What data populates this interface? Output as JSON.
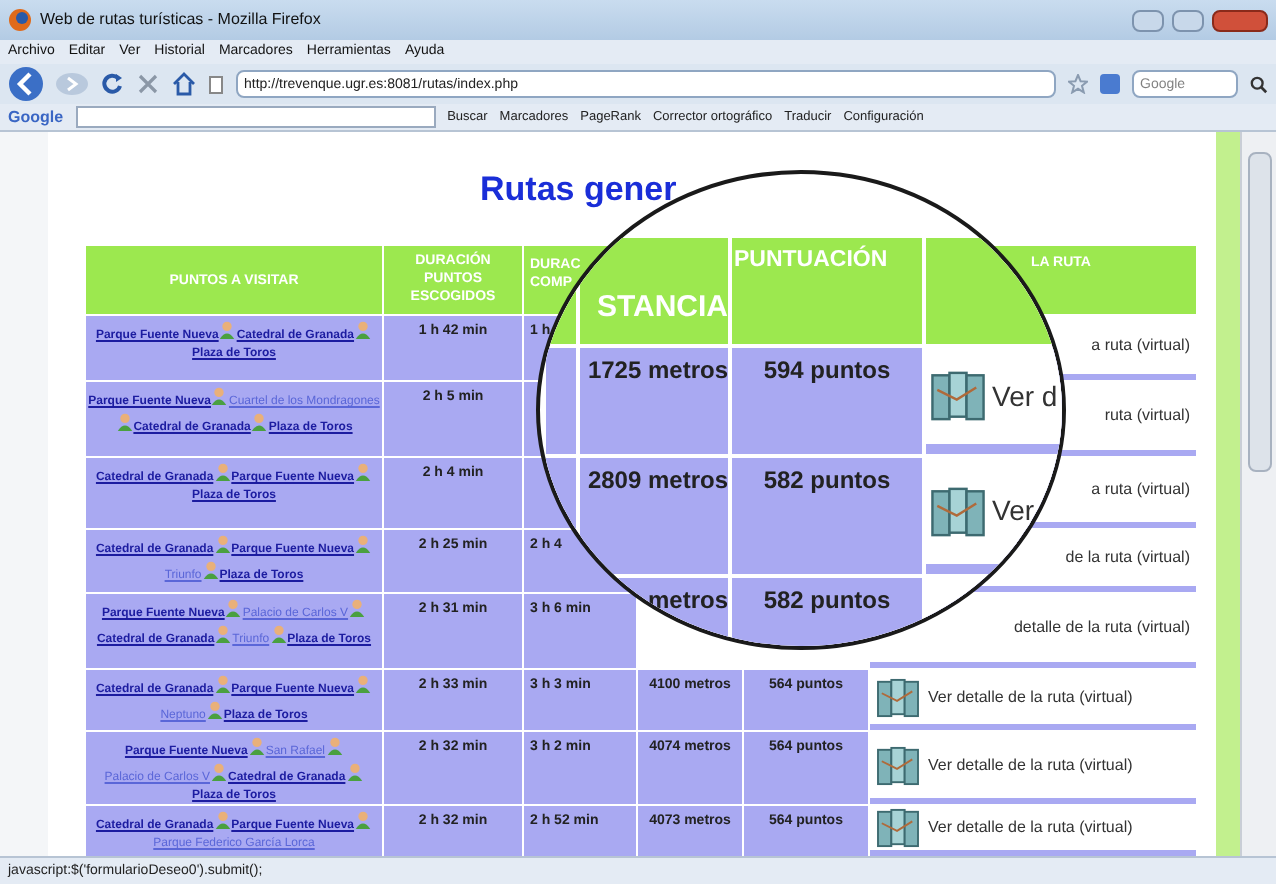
{
  "window": {
    "title": "Web de rutas turísticas - Mozilla Firefox"
  },
  "menu": [
    "Archivo",
    "Editar",
    "Ver",
    "Historial",
    "Marcadores",
    "Herramientas",
    "Ayuda"
  ],
  "address_bar": {
    "value": "http://trevenque.ugr.es:8081/rutas/index.php"
  },
  "search_box": {
    "placeholder": "Google"
  },
  "google_toolbar": {
    "logo": "Google",
    "items": [
      "Buscar",
      "Marcadores",
      "PageRank",
      "Corrector ortográfico",
      "Traducir",
      "Configuración"
    ]
  },
  "heading": "Rutas gener",
  "table": {
    "header": {
      "puntos": "PUNTOS A VISITAR",
      "duracion_puntos": "DURACIÓN PUNTOS ESCOGIDOS",
      "column_3": "DURAC COMP",
      "column_6": "LA RUTA"
    },
    "rows": [
      {
        "places": [
          {
            "name": "Parque Fuente Nueva",
            "optional": false
          },
          {
            "name": "Catedral de Granada",
            "optional": false
          },
          {
            "name": "Plaza de Toros",
            "optional": false
          }
        ],
        "duracion_puntos": "1 h 42 min",
        "column_3": "1 h",
        "column_6": "a ruta (virtual)",
        "map_icon": false
      },
      {
        "places": [
          {
            "name": "Parque Fuente Nueva",
            "optional": false
          },
          {
            "name": "Cuartel de los Mondragones",
            "optional": true
          },
          {
            "name": "Catedral de Granada",
            "optional": false
          },
          {
            "name": "Plaza de Toros",
            "optional": false
          }
        ],
        "duracion_puntos": "2 h 5 min",
        "column_6": "ruta (virtual)",
        "map_icon": false
      },
      {
        "places": [
          {
            "name": "Catedral de Granada",
            "optional": false
          },
          {
            "name": "Parque Fuente Nueva",
            "optional": false
          },
          {
            "name": "Plaza de Toros",
            "optional": false
          }
        ],
        "duracion_puntos": "2 h 4 min",
        "column_6": "a ruta (virtual)",
        "map_icon": false
      },
      {
        "places": [
          {
            "name": "Catedral de Granada",
            "optional": false
          },
          {
            "name": "Parque Fuente Nueva",
            "optional": false
          },
          {
            "name": "Triunfo",
            "optional": true
          },
          {
            "name": "Plaza de Toros",
            "optional": false
          }
        ],
        "duracion_puntos": "2 h 25 min",
        "column_3": "2 h 4",
        "column_6": "de la ruta (virtual)",
        "map_icon": false
      },
      {
        "places": [
          {
            "name": "Parque Fuente Nueva",
            "optional": false
          },
          {
            "name": "Palacio de Carlos V",
            "optional": true
          },
          {
            "name": "Catedral de Granada",
            "optional": false
          },
          {
            "name": "Triunfo",
            "optional": true
          },
          {
            "name": "Plaza de Toros",
            "optional": false
          }
        ],
        "duracion_puntos": "2 h 31 min",
        "column_3": "3 h 6 min",
        "column_6": "detalle de la ruta (virtual)",
        "map_icon": false
      },
      {
        "places": [
          {
            "name": "Catedral de Granada",
            "optional": false
          },
          {
            "name": "Parque Fuente Nueva",
            "optional": false
          },
          {
            "name": "Neptuno",
            "optional": true
          },
          {
            "name": "Plaza de Toros",
            "optional": false
          }
        ],
        "duracion_puntos": "2 h 33 min",
        "column_3": "3 h 3 min",
        "column_4": "4100 metros",
        "column_5": "564 puntos",
        "column_6": "Ver detalle de la ruta (virtual)",
        "map_icon": true
      },
      {
        "places": [
          {
            "name": "Parque Fuente Nueva",
            "optional": false
          },
          {
            "name": "San Rafael",
            "optional": true
          },
          {
            "name": "Palacio de Carlos V",
            "optional": true
          },
          {
            "name": "Catedral de Granada",
            "optional": false
          },
          {
            "name": "Plaza de Toros",
            "optional": false
          }
        ],
        "duracion_puntos": "2 h 32 min",
        "column_3": "3 h 2 min",
        "column_4": "4074 metros",
        "column_5": "564 puntos",
        "column_6": "Ver detalle de la ruta (virtual)",
        "map_icon": true
      },
      {
        "places": [
          {
            "name": "Catedral de Granada",
            "optional": false
          },
          {
            "name": "Parque Fuente Nueva",
            "optional": false
          },
          {
            "name": "Parque Federico García Lorca",
            "optional": true
          }
        ],
        "duracion_puntos": "2 h 32 min",
        "column_3": "2 h 52 min",
        "column_4": "4073 metros",
        "column_5": "564 puntos",
        "column_6": "Ver detalle de la ruta (virtual)",
        "map_icon": true
      }
    ]
  },
  "magnifier": {
    "header": [
      "STANCIA",
      "PUNTUACIÓN"
    ],
    "rows": [
      {
        "distance": "1725 metros",
        "points": "594 puntos",
        "link": "Ver d",
        "map_icon": true
      },
      {
        "distance": "2809 metros",
        "points": "582 puntos",
        "link": "Ver",
        "map_icon": true
      },
      {
        "distance": "metros",
        "points": "582 puntos",
        "map_icon": false
      }
    ]
  },
  "status_bar": "javascript:$('formularioDeseo0').submit();"
}
